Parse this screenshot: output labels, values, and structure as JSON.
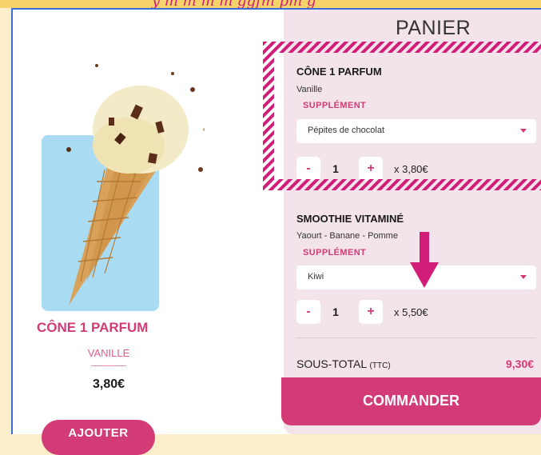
{
  "banner": {
    "text": "y m m m m ggfm pm g"
  },
  "product": {
    "name": "CÔNE 1 PARFUM",
    "flavor": "VANILLE",
    "price": "3,80€",
    "add_label": "AJOUTER"
  },
  "cart": {
    "title": "PANIER",
    "items": [
      {
        "name": "CÔNE 1 PARFUM",
        "desc": "Vanille",
        "supplement_label": "SUPPLÉMENT",
        "supplement_value": "Pépites de chocolat",
        "minus": "-",
        "qty": "1",
        "plus": "+",
        "unit_price": "x 3,80€"
      },
      {
        "name": "SMOOTHIE VITAMINÉ",
        "desc": "Yaourt - Banane - Pomme",
        "supplement_label": "SUPPLÉMENT",
        "supplement_value": "Kiwi",
        "minus": "-",
        "qty": "1",
        "plus": "+",
        "unit_price": "x 5,50€"
      }
    ],
    "subtotal_label": "SOUS-TOTAL",
    "subtotal_tax": "(TTC)",
    "subtotal_value": "9,30€",
    "order_label": "COMMANDER"
  },
  "colors": {
    "accent": "#d23b76",
    "cart_bg": "#f3e3ea",
    "product_bg": "#a9dcf2"
  }
}
